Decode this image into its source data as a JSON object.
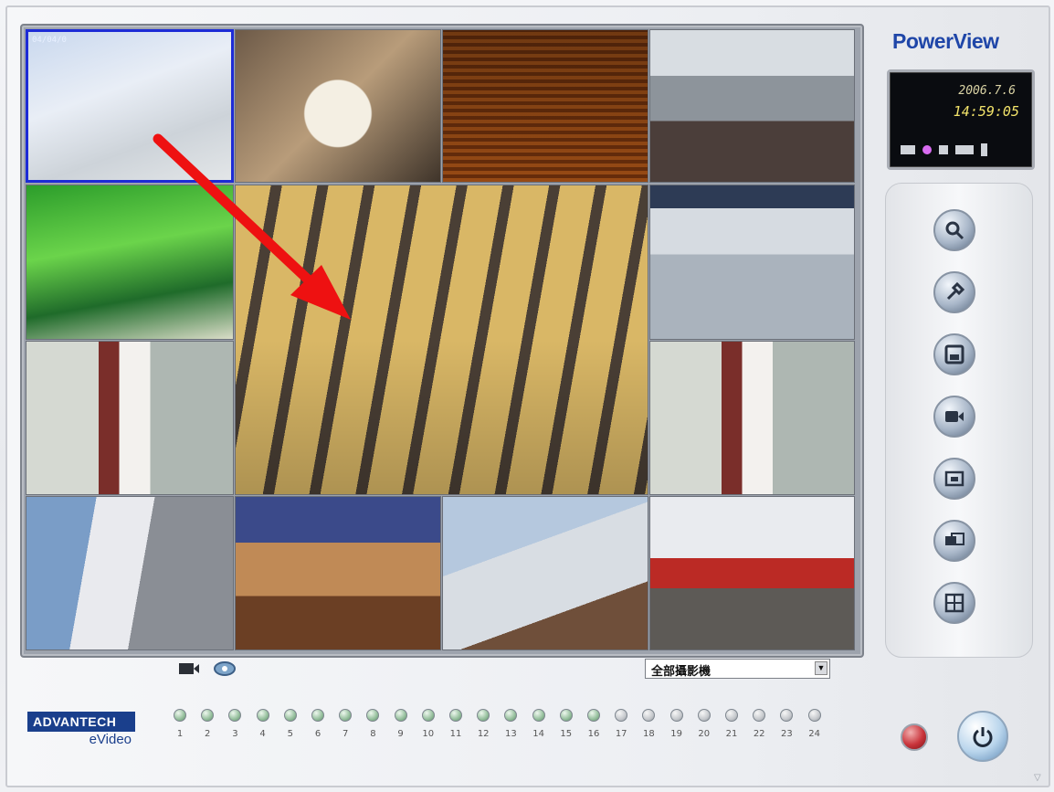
{
  "app": {
    "brand": "PowerView",
    "logo": {
      "company": "ADVANTECH",
      "product": "eVideo"
    }
  },
  "status_display": {
    "date": "2006.7.6",
    "time": "14:59:05"
  },
  "camera_selector": {
    "value": "全部攝影機"
  },
  "cameras": {
    "selected_overlay_text": "04/04/0",
    "channels": [
      {
        "num": "1",
        "state": "on"
      },
      {
        "num": "2",
        "state": "on"
      },
      {
        "num": "3",
        "state": "on"
      },
      {
        "num": "4",
        "state": "on"
      },
      {
        "num": "5",
        "state": "on"
      },
      {
        "num": "6",
        "state": "on"
      },
      {
        "num": "7",
        "state": "on"
      },
      {
        "num": "8",
        "state": "on"
      },
      {
        "num": "9",
        "state": "on"
      },
      {
        "num": "10",
        "state": "on"
      },
      {
        "num": "11",
        "state": "on"
      },
      {
        "num": "12",
        "state": "on"
      },
      {
        "num": "13",
        "state": "on"
      },
      {
        "num": "14",
        "state": "on"
      },
      {
        "num": "15",
        "state": "on"
      },
      {
        "num": "16",
        "state": "on"
      },
      {
        "num": "17",
        "state": "off"
      },
      {
        "num": "18",
        "state": "off"
      },
      {
        "num": "19",
        "state": "off"
      },
      {
        "num": "20",
        "state": "off"
      },
      {
        "num": "21",
        "state": "off"
      },
      {
        "num": "22",
        "state": "off"
      },
      {
        "num": "23",
        "state": "off"
      },
      {
        "num": "24",
        "state": "off"
      }
    ]
  },
  "side_buttons": [
    "search-icon",
    "tools-icon",
    "save-icon",
    "record-camera-icon",
    "snapshot-icon",
    "playback-icon",
    "layout-grid-icon"
  ],
  "colors": {
    "selected_border": "#1d2bd6",
    "arrow": "#ee1111",
    "brand": "#1f46a8"
  }
}
